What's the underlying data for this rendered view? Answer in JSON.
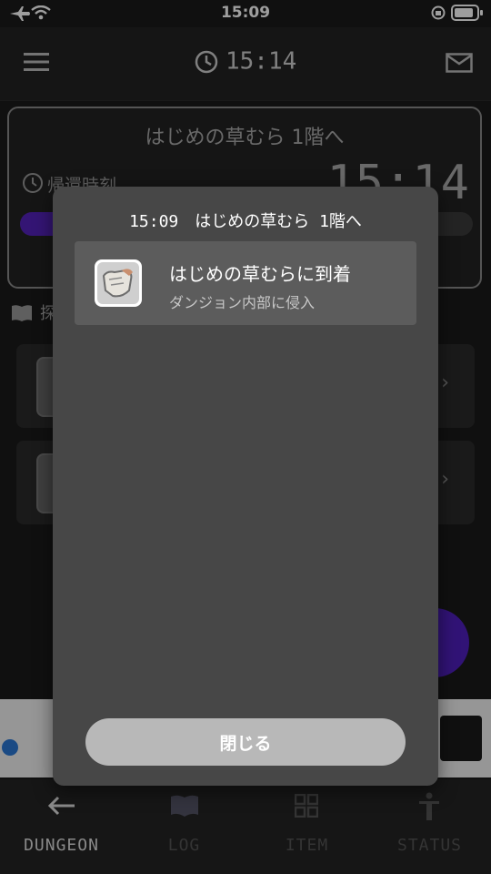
{
  "status_bar": {
    "time": "15:09"
  },
  "header": {
    "clock_time": "15:14"
  },
  "dungeon_card": {
    "title": "はじめの草むら 1階へ",
    "return_label": "帰還時刻",
    "return_time": "15:14",
    "progress": 0.15
  },
  "section": {
    "label": "探"
  },
  "modal": {
    "title": "15:09　はじめの草むら 1階へ",
    "item": {
      "title": "はじめの草むらに到着",
      "subtitle": "ダンジョン内部に侵入",
      "icon": "glove-icon"
    },
    "close_label": "閉じる"
  },
  "nav": [
    {
      "label": "DUNGEON",
      "icon": "arrow-left-icon",
      "active": true
    },
    {
      "label": "LOG",
      "icon": "book-icon",
      "active": false
    },
    {
      "label": "ITEM",
      "icon": "grid-icon",
      "active": false
    },
    {
      "label": "STATUS",
      "icon": "person-icon",
      "active": false
    }
  ],
  "colors": {
    "accent": "#5522bb",
    "background": "#1b1b1b",
    "modal": "#474747"
  }
}
